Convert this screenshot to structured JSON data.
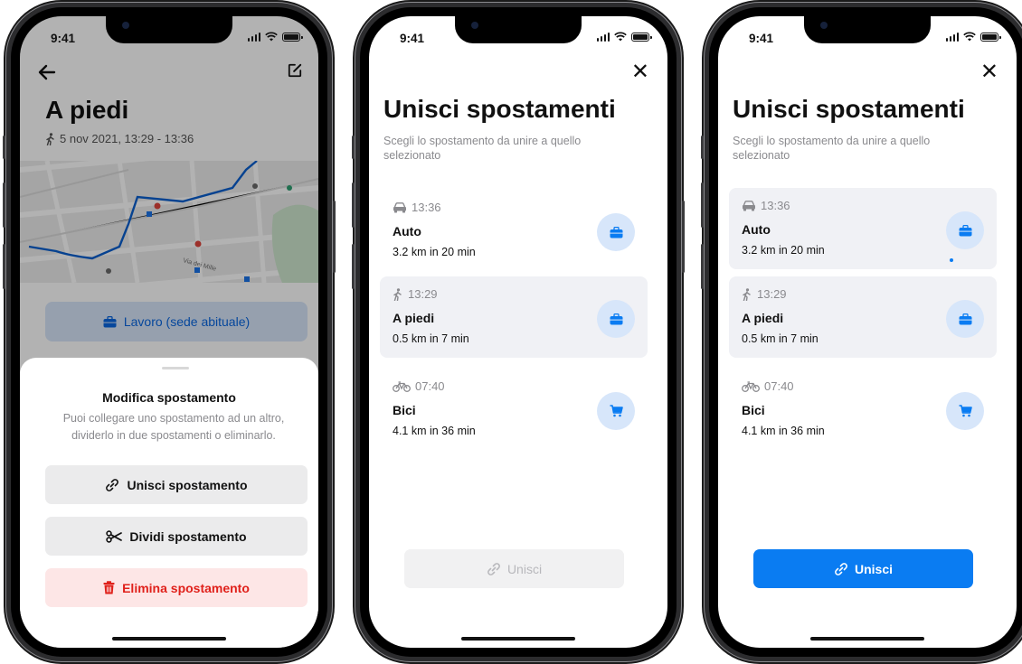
{
  "status": {
    "time": "9:41"
  },
  "phone1": {
    "title": "A piedi",
    "subtitle": "5 nov 2021, 13:29 - 13:36",
    "map_labels": [
      "Via dei Mille"
    ],
    "work_button": "Lavoro (sede abituale)",
    "sheet": {
      "title": "Modifica spostamento",
      "description": "Puoi collegare uno spostamento ad un altro, dividerlo in due spostamenti o eliminarlo.",
      "merge_label": "Unisci spostamento",
      "split_label": "Dividi spostamento",
      "delete_label": "Elimina spostamento"
    }
  },
  "phone2": {
    "title": "Unisci spostamenti",
    "subtitle": "Scegli lo spostamento da unire a quello selezionato",
    "trips": [
      {
        "time": "13:36",
        "mode": "Auto",
        "distance": "3.2 km in 20 min",
        "icon": "car-icon",
        "badge": "briefcase-icon"
      },
      {
        "time": "13:29",
        "mode": "A piedi",
        "distance": "0.5 km in 7 min",
        "icon": "walk-icon",
        "badge": "briefcase-icon"
      },
      {
        "time": "07:40",
        "mode": "Bici",
        "distance": "4.1 km in 36 min",
        "icon": "bike-icon",
        "badge": "cart-icon"
      }
    ],
    "merge_label": "Unisci",
    "merge_enabled": false
  },
  "phone3": {
    "title": "Unisci spostamenti",
    "subtitle": "Scegli lo spostamento da unire a quello selezionato",
    "trips": [
      {
        "time": "13:36",
        "mode": "Auto",
        "distance": "3.2 km in 20 min",
        "icon": "car-icon",
        "badge": "briefcase-icon"
      },
      {
        "time": "13:29",
        "mode": "A piedi",
        "distance": "0.5 km in 7 min",
        "icon": "walk-icon",
        "badge": "briefcase-icon"
      },
      {
        "time": "07:40",
        "mode": "Bici",
        "distance": "4.1 km in 36 min",
        "icon": "bike-icon",
        "badge": "cart-icon"
      }
    ],
    "merge_label": "Unisci",
    "merge_enabled": true
  },
  "colors": {
    "accent": "#0a7cf2",
    "badge_bg": "#d7e6fa",
    "danger": "#e0211b",
    "danger_bg": "#fde6e6",
    "selected_bg": "#f0f1f5"
  }
}
